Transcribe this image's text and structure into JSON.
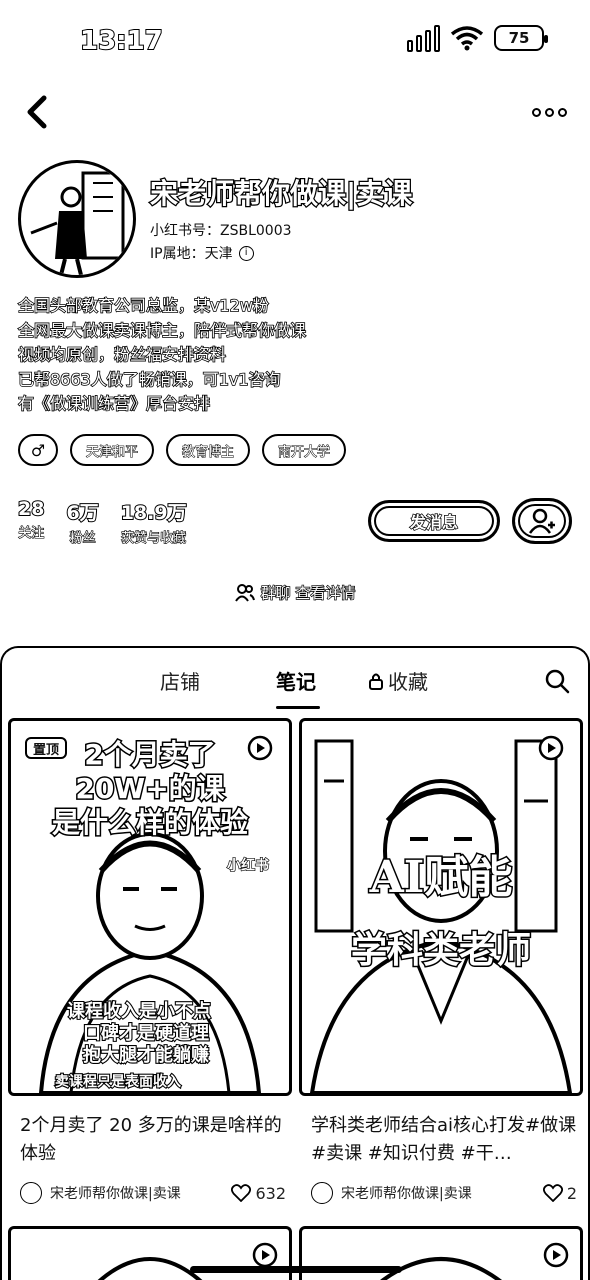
{
  "status_bar": {
    "time": "13:17",
    "battery": "75"
  },
  "profile": {
    "name": "宋老师帮你做课|卖课",
    "id_line": "小红书号：ZSBL0003",
    "ip_line": "IP属地：天津",
    "bio": [
      "全国头部教育公司总监，某v12w粉",
      "全网最大做课卖课博主，陪伴式帮你做课",
      "视频均原创，粉丝福安排资料",
      "已帮8663人做了畅销课，可1v1咨询",
      "有《做课训练营》厚台安排"
    ],
    "tags": [
      {
        "label": "♂",
        "icon": "male-icon"
      },
      {
        "label": "天津和平"
      },
      {
        "label": "教育博主"
      },
      {
        "label": "南开大学"
      }
    ],
    "stats": [
      {
        "num": "28",
        "label": "关注"
      },
      {
        "num": "6万",
        "label": "粉丝"
      },
      {
        "num": "18.9万",
        "label": "获赞与收藏"
      }
    ],
    "message_button": "发消息",
    "group_chat": "群聊  查看详情"
  },
  "tabs": {
    "shop": "店铺",
    "notes": "笔记",
    "collect": "收藏",
    "active": "notes"
  },
  "notes": [
    {
      "pinned": "置顶",
      "overlay_line1": "2个月卖了",
      "overlay_line2": "20W+的课",
      "overlay_line3": "是什么样的体验",
      "watermark": "小红书",
      "overlay_bottom1": "课程收入是小不点",
      "overlay_bottom2": "口碑才是硬道理",
      "overlay_bottom3": "抱大腿才能躺赚",
      "overlay_bottom4": "卖课程只是表面收入",
      "caption": "2个月卖了 20 多万的课是啥样的体验",
      "author": "宋老师帮你做课|卖课",
      "likes": "632"
    },
    {
      "overlay_line1": "AI赋能",
      "overlay_line2": "学科类老师",
      "caption": "学科类老师结合ai核心打发#做课 #卖课 #知识付费 #干…",
      "author": "宋老师帮你做课|卖课",
      "likes": "2"
    }
  ]
}
